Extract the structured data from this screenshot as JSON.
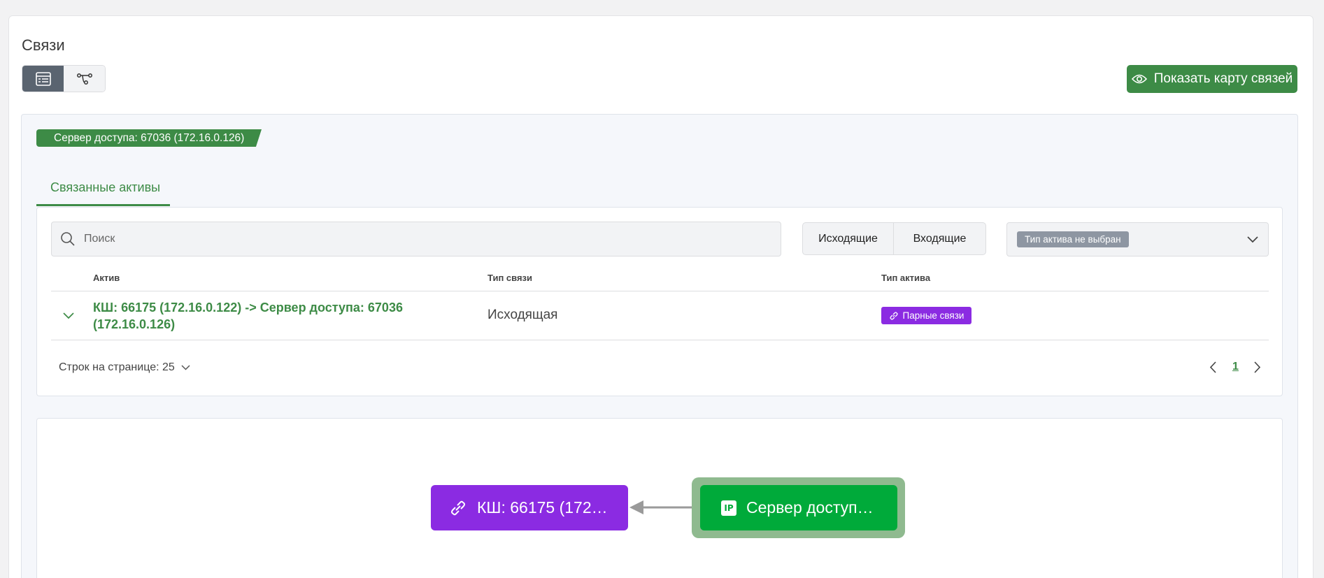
{
  "page": {
    "title": "Связи"
  },
  "toolbar": {
    "show_map_label": "Показать карту связей"
  },
  "asset": {
    "tag": "Сервер доступа: 67036 (172.16.0.126)"
  },
  "tabs": [
    {
      "label": "Связанные активы",
      "active": true
    }
  ],
  "filters": {
    "search_placeholder": "Поиск",
    "search_value": "",
    "direction": {
      "outgoing": "Исходящие",
      "incoming": "Входящие"
    },
    "asset_type": {
      "value": "Тип актива не выбран"
    }
  },
  "table": {
    "columns": [
      "Актив",
      "Тип связи",
      "Тип актива"
    ],
    "rows": [
      {
        "asset": "КШ: 66175 (172.16.0.122) -> Сервер доступа: 67036 (172.16.0.126)",
        "link_type": "Исходящая",
        "asset_type": "Парные связи"
      }
    ]
  },
  "pagination": {
    "rows_per_page": "Строк на странице: 25",
    "current_page": "1"
  },
  "graph": {
    "nodes": [
      {
        "label": "КШ: 66175 (172…",
        "icon": "link-icon",
        "color": "#8b2be2"
      },
      {
        "label": "Сервер доступ…",
        "icon": "ip-icon",
        "icon_text": "IP",
        "color": "#00aa3a",
        "selected": true
      }
    ]
  },
  "colors": {
    "accent": "#3d8b46",
    "pair_badge": "#8b2be2",
    "node_green": "#00aa3a"
  }
}
